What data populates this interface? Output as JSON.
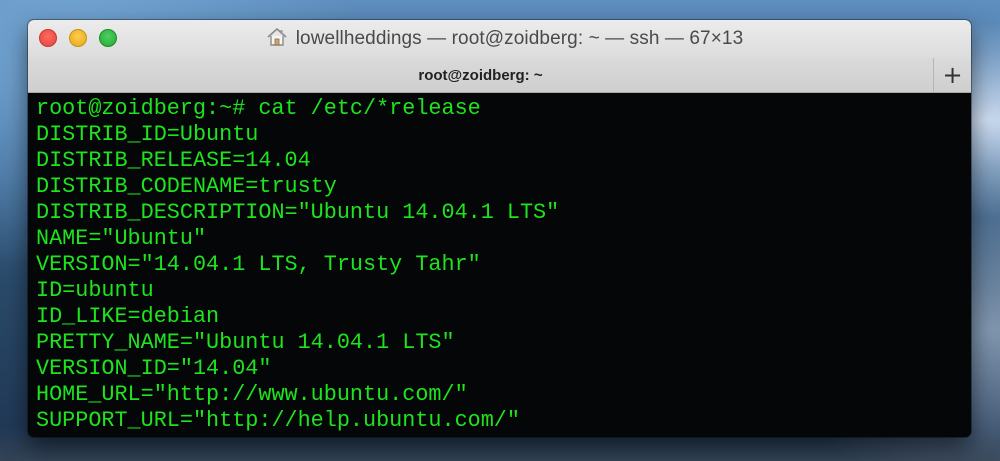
{
  "window": {
    "title": "lowellheddings — root@zoidberg: ~ — ssh — 67×13",
    "title_icon": "home-icon",
    "buttons": {
      "close": "close-button",
      "minimize": "minimize-button",
      "zoom": "zoom-button"
    }
  },
  "tabs": [
    {
      "label": "root@zoidberg: ~",
      "active": true
    }
  ],
  "new_tab_label": "+",
  "terminal": {
    "text_color": "#1ee31e",
    "background": "#050607",
    "lines": [
      "root@zoidberg:~# cat /etc/*release",
      "DISTRIB_ID=Ubuntu",
      "DISTRIB_RELEASE=14.04",
      "DISTRIB_CODENAME=trusty",
      "DISTRIB_DESCRIPTION=\"Ubuntu 14.04.1 LTS\"",
      "NAME=\"Ubuntu\"",
      "VERSION=\"14.04.1 LTS, Trusty Tahr\"",
      "ID=ubuntu",
      "ID_LIKE=debian",
      "PRETTY_NAME=\"Ubuntu 14.04.1 LTS\"",
      "VERSION_ID=\"14.04\"",
      "HOME_URL=\"http://www.ubuntu.com/\"",
      "SUPPORT_URL=\"http://help.ubuntu.com/\""
    ]
  }
}
